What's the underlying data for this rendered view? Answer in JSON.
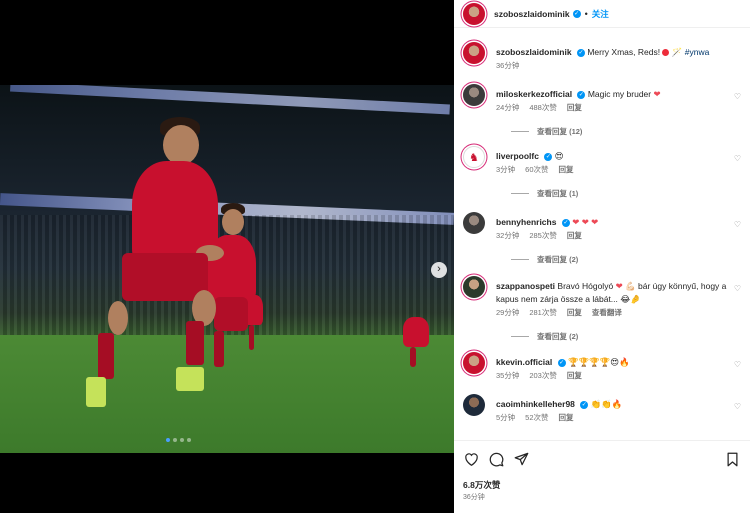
{
  "header": {
    "username": "szoboszlaidominik",
    "follow_label": "关注",
    "separator": "•"
  },
  "caption": {
    "username": "szoboszlaidominik",
    "text": "Merry Xmas, Reds!",
    "hashtag": "#ynwa",
    "time": "36分钟"
  },
  "comments": [
    {
      "username": "miloskerkezofficial",
      "text": "Magic my bruder",
      "heart": true,
      "time": "24分钟",
      "likes": "488次赞",
      "reply": "回复",
      "view_replies": "查看回复 (12)"
    },
    {
      "username": "liverpoolfc",
      "text": "",
      "heart_eyes": true,
      "time": "3分钟",
      "likes": "60次赞",
      "reply": "回复",
      "view_replies": "查看回复 (1)"
    },
    {
      "username": "bennyhenrichs",
      "text": "",
      "hearts": "❤ ❤ ❤",
      "time": "32分钟",
      "likes": "285次赞",
      "reply": "回复",
      "view_replies": "查看回复 (2)"
    },
    {
      "username": "szappanospeti",
      "text": "Bravó Hógolyó",
      "text2": "bár úgy könnyű, hogy a kapus nem zárja össze a lábát...",
      "time": "29分钟",
      "likes": "281次赞",
      "reply": "回复",
      "translate": "查看翻译",
      "view_replies": "查看回复 (2)"
    },
    {
      "username": "kkevin.official",
      "text": "",
      "time": "35分钟",
      "likes": "203次赞",
      "reply": "回复"
    },
    {
      "username": "caoimhinkelleher98",
      "text": "",
      "time": "5分钟",
      "likes": "52次赞",
      "reply": "回复"
    }
  ],
  "footer": {
    "likes": "6.8万次赞",
    "time": "36分钟"
  },
  "icons": {
    "next": "›",
    "heart": "heart-icon",
    "comment": "comment-icon",
    "share": "share-icon",
    "bookmark": "bookmark-icon"
  },
  "colors": {
    "accent": "#0095f6",
    "liverpool_red": "#c8102e"
  }
}
